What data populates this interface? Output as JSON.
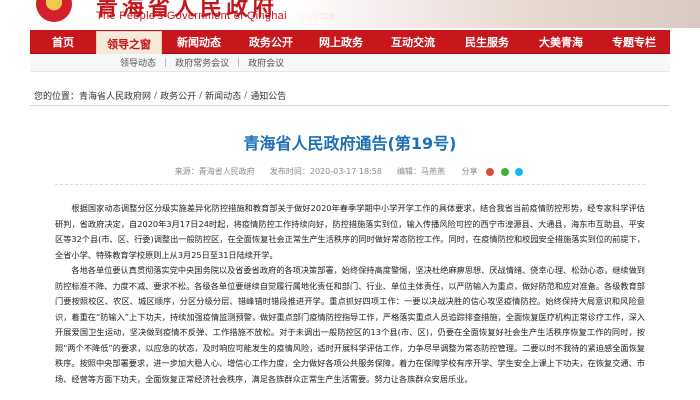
{
  "header": {
    "site_title": "青海省人民政府",
    "site_subtitle": "The People's Government of Qinghai Province"
  },
  "nav": {
    "items": [
      {
        "label": "首页"
      },
      {
        "label": "领导之窗"
      },
      {
        "label": "新闻动态"
      },
      {
        "label": "政务公开"
      },
      {
        "label": "网上政务"
      },
      {
        "label": "互动交流"
      },
      {
        "label": "民生服务"
      },
      {
        "label": "大美青海"
      },
      {
        "label": "专题专栏"
      }
    ],
    "active_index": 1
  },
  "subnav": {
    "items": [
      {
        "label": "领导动态"
      },
      {
        "label": "政府常务会议"
      },
      {
        "label": "政府会议"
      }
    ]
  },
  "breadcrumb": {
    "prefix": "您的位置：",
    "items": [
      "青海省人民政府网",
      "政务公开",
      "新闻动态",
      "通知公告"
    ],
    "sep": "/"
  },
  "article": {
    "title": "青海省人民政府通告(第19号)",
    "meta": {
      "source_label": "来源：",
      "source": "青海省人民政府",
      "date_label": "发布时间：",
      "date": "2020-03-17 18:58",
      "editor_label": "编辑：",
      "editor": "马燕燕",
      "share_label": "分享"
    },
    "paragraphs": [
      "根据国家动态调整分区分级实施差异化防控措施和教育部关于做好2020年春季学期中小学开学工作的具体要求，结合我省当前疫情防控形势，经专家科学评估研判，省政府决定，自2020年3月17日24时起，将疫情防控工作持续向好，防控措施落实到位，输入传播风险可控的西宁市湟源县、大通县，海东市互助县、平安区等32个县(市、区、行委)调整出一般防控区，在全面恢复社会正常生产生活秩序的同时做好常态防控工作。同时，在疫情防控和校园安全措施落实到位的前提下，全省小学、特殊教育学校原则上从3月25日至31日陆续开学。",
      "各地各单位要认真贯彻落实党中央国务院以及省委省政府的各项决策部署，始终保持高度警惕，坚决杜绝麻痹思想、厌战情绪、侥幸心理、松劲心态，继续做到防控标准不降、力度不减、要求不松。各级各单位要继续自觉履行属地化责任和部门、行业、单位主体责任，以严防输入为重点，做好防范和应对准备。各级教育部门要按照校区、农区、城区顺序，分区分级分层、错峰错时错段推进开学。重点抓好四项工作：一要以决战决胜的信心攻坚疫情防控。始终保持大局意识和风险意识，着重在“防输入”上下功夫，持续加强疫情监测预警，做好重点部门疫情防控指导工作，严格落实重点人员追踪排查措施，全面恢复医疗机构正常诊疗工作，深入开展爱国卫生运动，坚决做到疫情不反弹、工作措施不放松。对于未调出一般防控区的13个县(市、区)，仍要在全面恢复好社会生产生活秩序恢复工作的同时，按照“两个不降低”的要求，以应急的状态，及时响应可能发生的疫情风险，适时开展科学评估工作，力争尽早调整为常态防控管理。二要以时不我待的紧迫感全面恢复秩序。按照中央部署要求，进一步加大稳人心、增信心工作力度，全力做好各项公共服务保障，着力在保障学校有序开学、学生安全上课上下功夫，在恢复交通、市场、经营等方面下功夫，全面恢复正常经济社会秩序，满足各族群众正常生产生活需要。努力让各族群众安居乐业。"
    ]
  },
  "colors": {
    "nav_red": "#c8161d",
    "title_blue": "#1f6fb6",
    "active_tab_bg": "#f3ead9"
  }
}
